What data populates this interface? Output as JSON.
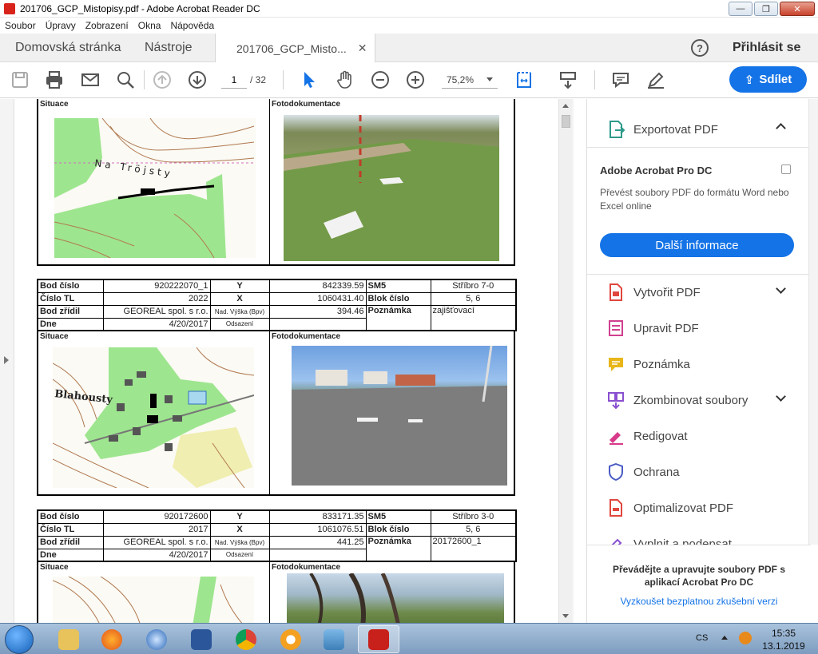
{
  "window": {
    "title": "201706_GCP_Mistopisy.pdf - Adobe Acrobat Reader DC"
  },
  "menu": [
    "Soubor",
    "Úpravy",
    "Zobrazení",
    "Okna",
    "Nápověda"
  ],
  "tabs": {
    "home": "Domovská stránka",
    "tools": "Nástroje",
    "doc": "201706_GCP_Misto..."
  },
  "signin": "Přihlásit se",
  "toolbar": {
    "page_current": "1",
    "page_total": "/ 32",
    "zoom": "75,2%",
    "share": "Sdílet"
  },
  "document": {
    "record0": {
      "situace": "Situace",
      "foto": "Fotodokumentace",
      "map_text": "Na Tröjsty"
    },
    "record1": {
      "bod_cislo_label": "Bod číslo",
      "bod_cislo": "920222070_1",
      "y_label": "Y",
      "y": "842339.59",
      "sm5_label": "SM5",
      "sm5": "Stříbro 7-0",
      "cislo_tl_label": "Číslo TL",
      "cislo_tl": "2022",
      "x_label": "X",
      "x": "1060431.40",
      "blok_label": "Blok číslo",
      "blok": "5, 6",
      "zridil_label": "Bod zřídil",
      "zridil": "GEOREAL spol. s r.o.",
      "vyska_label": "Nad. Výška (Bpv)",
      "vyska": "394.46",
      "poznamka_label": "Poznámka",
      "poznamka": "zajišťovací",
      "dne_label": "Dne",
      "dne": "4/20/2017",
      "odsazeni_label": "Odsazení",
      "situace": "Situace",
      "foto": "Fotodokumentace",
      "map_text": "Blahousty"
    },
    "record2": {
      "bod_cislo_label": "Bod číslo",
      "bod_cislo": "920172600",
      "y_label": "Y",
      "y": "833171.35",
      "sm5_label": "SM5",
      "sm5": "Stříbro 3-0",
      "cislo_tl_label": "Číslo TL",
      "cislo_tl": "2017",
      "x_label": "X",
      "x": "1061076.51",
      "blok_label": "Blok číslo",
      "blok": "5, 6",
      "zridil_label": "Bod zřídil",
      "zridil": "GEOREAL spol. s r.o.",
      "vyska_label": "Nad. Výška (Bpv)",
      "vyska": "441.25",
      "poznamka_label": "Poznámka",
      "poznamka": "20172600_1",
      "dne_label": "Dne",
      "dne": "4/20/2017",
      "odsazeni_label": "Odsazení",
      "situace": "Situace",
      "foto": "Fotodokumentace"
    }
  },
  "right_panel": {
    "export": "Exportovat PDF",
    "promo_title": "Adobe Acrobat Pro DC",
    "promo_desc": "Převést soubory PDF do formátu Word nebo Excel online",
    "promo_button": "Další informace",
    "tools": [
      "Vytvořit PDF",
      "Upravit PDF",
      "Poznámka",
      "Zkombinovat soubory",
      "Redigovat",
      "Ochrana",
      "Optimalizovat PDF",
      "Vyplnit a podepsat"
    ],
    "tool_colors": [
      "#e0473e",
      "#d0408f",
      "#e8b619",
      "#8a4fd0",
      "#d83a8a",
      "#4a5bc4",
      "#e0473e",
      "#8a4fd0"
    ],
    "footer_text": "Převádějte a upravujte soubory PDF s aplikací Acrobat Pro DC",
    "footer_link": "Vyzkoušet bezplatnou zkušební verzi"
  },
  "taskbar": {
    "lang": "CS",
    "time": "15:35",
    "date": "13.1.2019"
  }
}
